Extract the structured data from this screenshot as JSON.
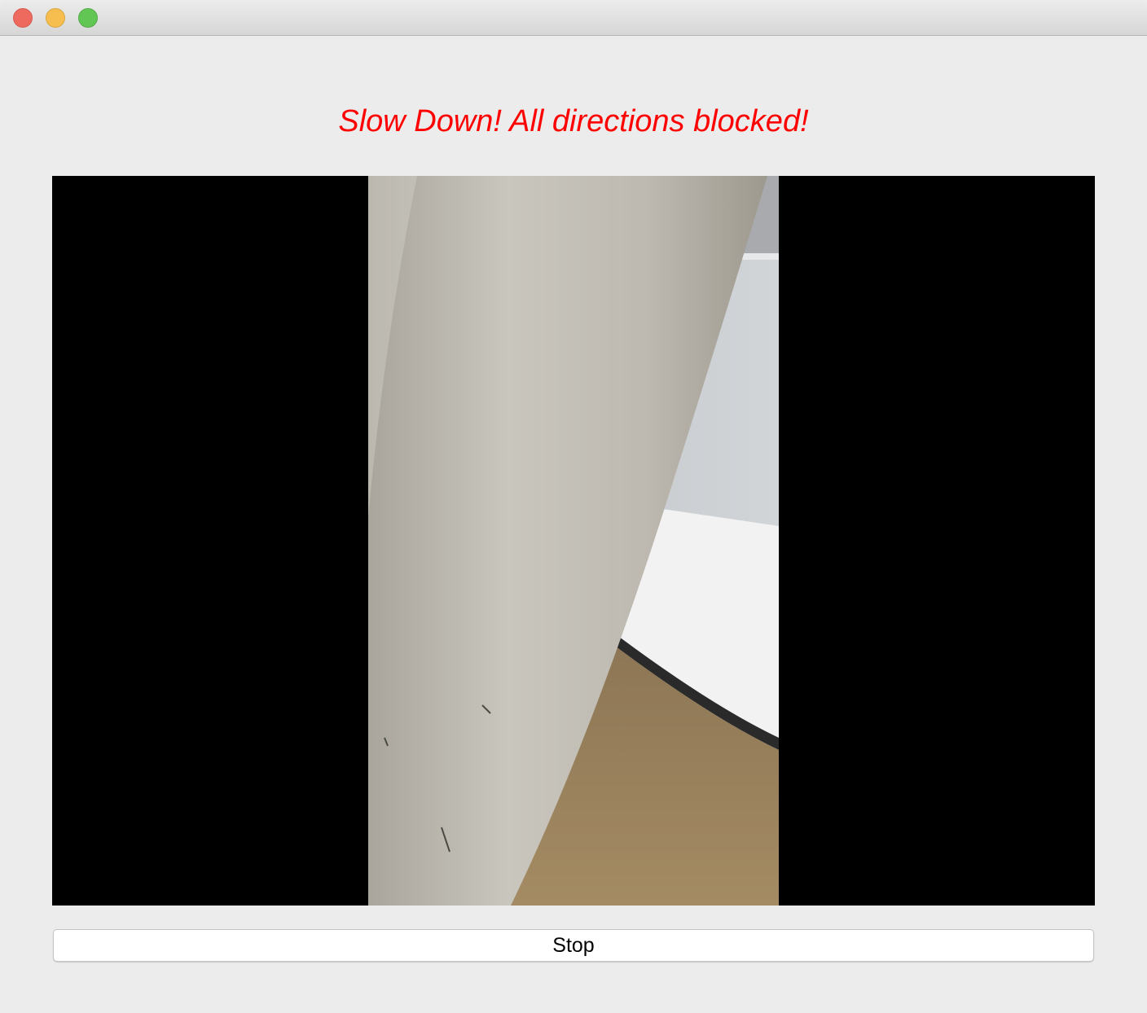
{
  "window": {
    "traffic_lights": [
      "close",
      "minimize",
      "zoom"
    ]
  },
  "status": {
    "message": "Slow Down! All directions blocked!",
    "color": "#ff0000"
  },
  "video": {
    "letterbox_color": "#000000"
  },
  "controls": {
    "stop_label": "Stop"
  }
}
